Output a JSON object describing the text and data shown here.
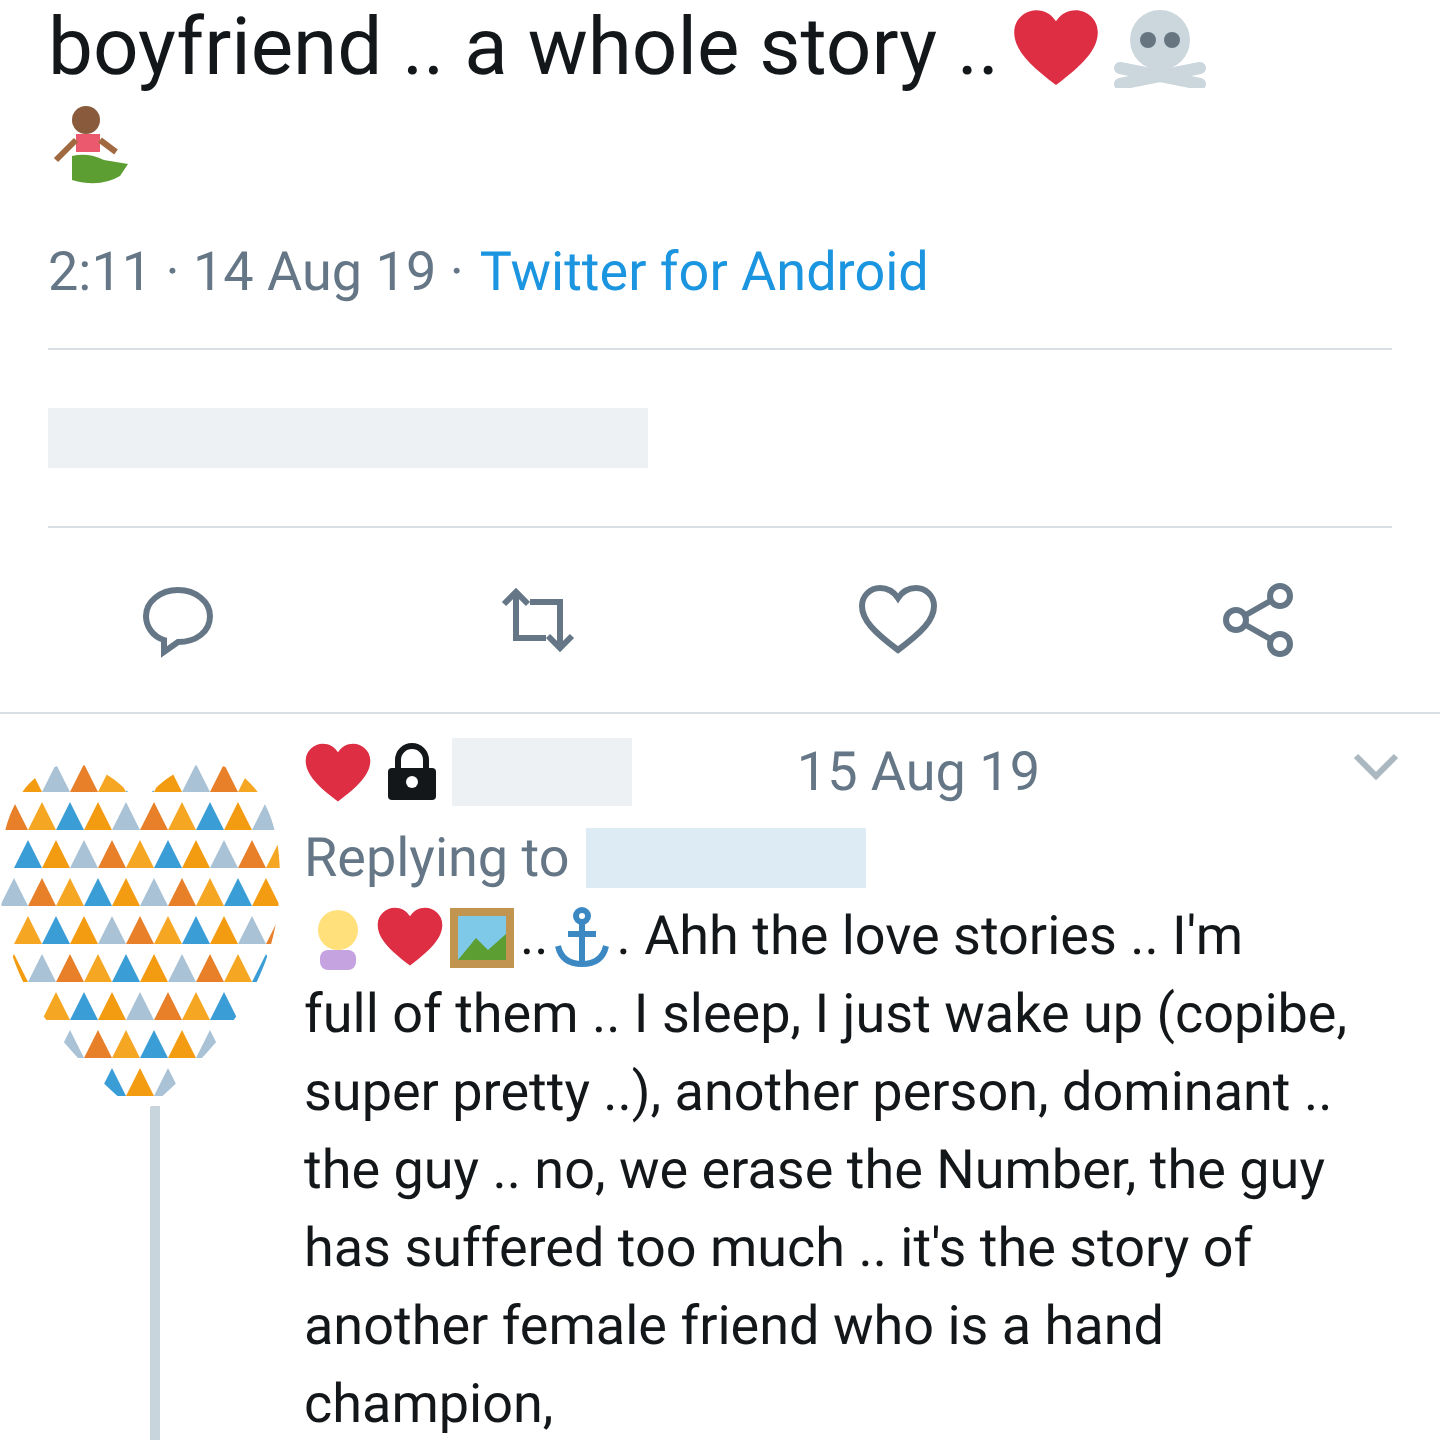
{
  "tweet": {
    "text": "boyfriend .. a whole story ..",
    "meta": "2:11 · 14 Aug 19 ·",
    "source": "Twitter for Android"
  },
  "reply": {
    "date": "15 Aug 19",
    "replying_label": "Replying to",
    "dots_1": "..",
    "dots_2": ". Ahh the love stories .. I'm",
    "body": "full of them .. I sleep, I just wake up (copibe, super pretty ..), another person, dominant .. the guy .. no, we erase the Number, the guy has suffered too much .. it's the story of another female friend who is a hand champion,"
  }
}
